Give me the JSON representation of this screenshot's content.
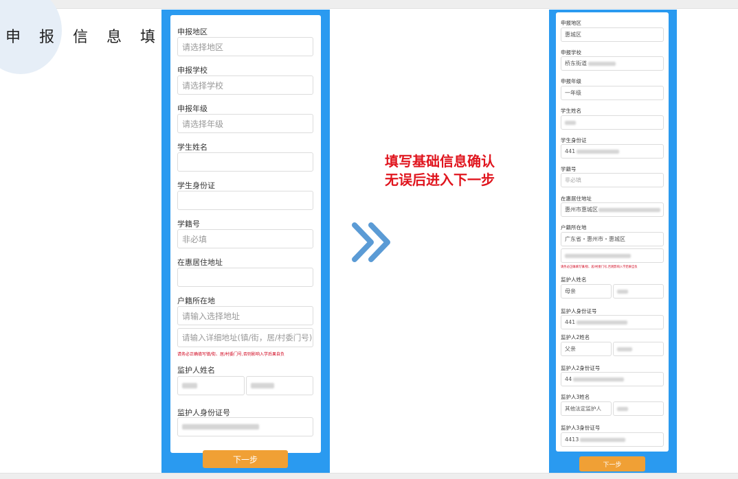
{
  "title": "申 报 信 息 填 写",
  "note": {
    "line1": "填写基础信息确认",
    "line2": "无误后进入下一步"
  },
  "icon": "double-chevron-right-icon",
  "colors": {
    "phone_bg": "#2a9af0",
    "button": "#f0a035",
    "note": "#e0151e",
    "warning": "#d0021b"
  },
  "form_empty": {
    "region_label": "申报地区",
    "region_placeholder": "请选择地区",
    "school_label": "申报学校",
    "school_placeholder": "请选择学校",
    "grade_label": "申报年级",
    "grade_placeholder": "请选择年级",
    "student_name_label": "学生姓名",
    "student_id_label": "学生身份证",
    "student_no_label": "学籍号",
    "student_no_placeholder": "非必填",
    "address_label": "在惠居住地址",
    "hukou_label": "户籍所在地",
    "hukou_placeholder": "请输入选择地址",
    "hukou_detail_placeholder": "请输入详细地址(镇/街，居/村委门号)",
    "warning": "请务必正确填写镇/街、居/村委门号,否则影响入学后果自负",
    "guardian_name_label": "监护人姓名",
    "guardian_id_label": "监护人身份证号",
    "next_button": "下一步"
  },
  "form_filled": {
    "region_label": "申报地区",
    "region_value": "惠城区",
    "school_label": "申报学校",
    "school_value": "桥东街道",
    "grade_label": "申报年级",
    "grade_value": "一年级",
    "student_name_label": "学生姓名",
    "student_id_label": "学生身份证",
    "student_id_value": "441",
    "student_no_label": "学籍号",
    "student_no_placeholder": "非必填",
    "address_label": "在惠居住地址",
    "address_value": "惠州市惠城区",
    "hukou_label": "户籍所在地",
    "hukou_value": "广东省・惠州市・惠城区",
    "warning": "请务必正确填写镇/街、居/村委门号,否则影响入学后果自负",
    "guardian_name_label": "监护人姓名",
    "guardian_relation": "母亲",
    "guardian_id_label": "监护人身份证号",
    "guardian_id_value": "441",
    "guardian2_name_label": "监护人2姓名",
    "guardian2_relation": "父亲",
    "guardian2_id_label": "监护人2身份证号",
    "guardian2_id_value": "44",
    "guardian3_name_label": "监护人3姓名",
    "guardian3_relation": "其他法定监护人",
    "guardian3_id_label": "监护人3身份证号",
    "guardian3_id_value": "4413",
    "next_button": "下一步"
  }
}
